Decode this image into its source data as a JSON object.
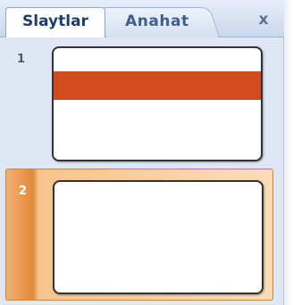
{
  "tabs": [
    {
      "label": "Slaytlar",
      "active": true
    },
    {
      "label": "Anahat",
      "active": false
    }
  ],
  "close_symbol": "x",
  "slides": [
    {
      "number": "1",
      "band_color": "#d24a1e",
      "selected": false
    },
    {
      "number": "2",
      "selected": true
    }
  ],
  "colors": {
    "selection": "#e28a3a",
    "pane_background": "#dfe7f4",
    "title_band": "#d24a1e"
  }
}
